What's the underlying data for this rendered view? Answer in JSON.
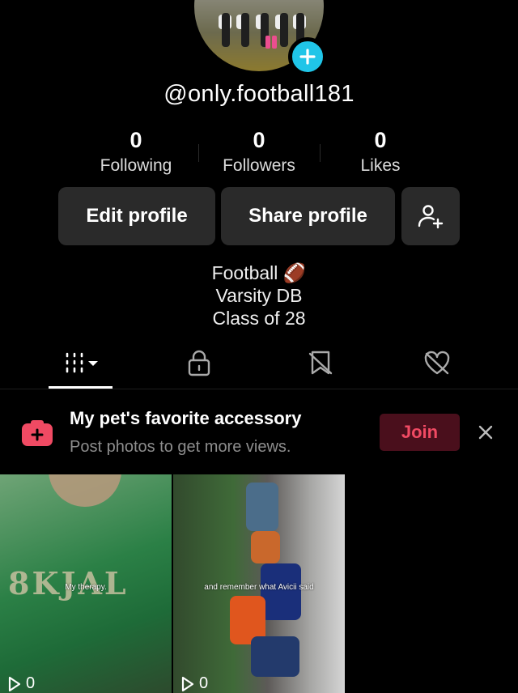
{
  "profile": {
    "username": "@only.football181",
    "stats": [
      {
        "value": "0",
        "label": "Following"
      },
      {
        "value": "0",
        "label": "Followers"
      },
      {
        "value": "0",
        "label": "Likes"
      }
    ],
    "edit_label": "Edit profile",
    "share_label": "Share profile",
    "bio": [
      "Football 🏈",
      "Varsity DB",
      "Class of 28"
    ]
  },
  "tabs": [
    {
      "icon": "grid-icon",
      "active": true
    },
    {
      "icon": "lock-icon",
      "active": false
    },
    {
      "icon": "bookmark-icon",
      "active": false
    },
    {
      "icon": "liked-heart-icon",
      "active": false
    }
  ],
  "promo": {
    "title": "My pet's favorite accessory",
    "subtitle": "Post photos to get more views.",
    "join_label": "Join",
    "accent": "#f04a63"
  },
  "videos": [
    {
      "caption": "My therapy.",
      "views": "0"
    },
    {
      "caption": "and remember what Avicii said",
      "views": "0"
    }
  ],
  "colors": {
    "background": "#000000",
    "button": "#2a2a2a",
    "badge": "#20c5e8"
  }
}
